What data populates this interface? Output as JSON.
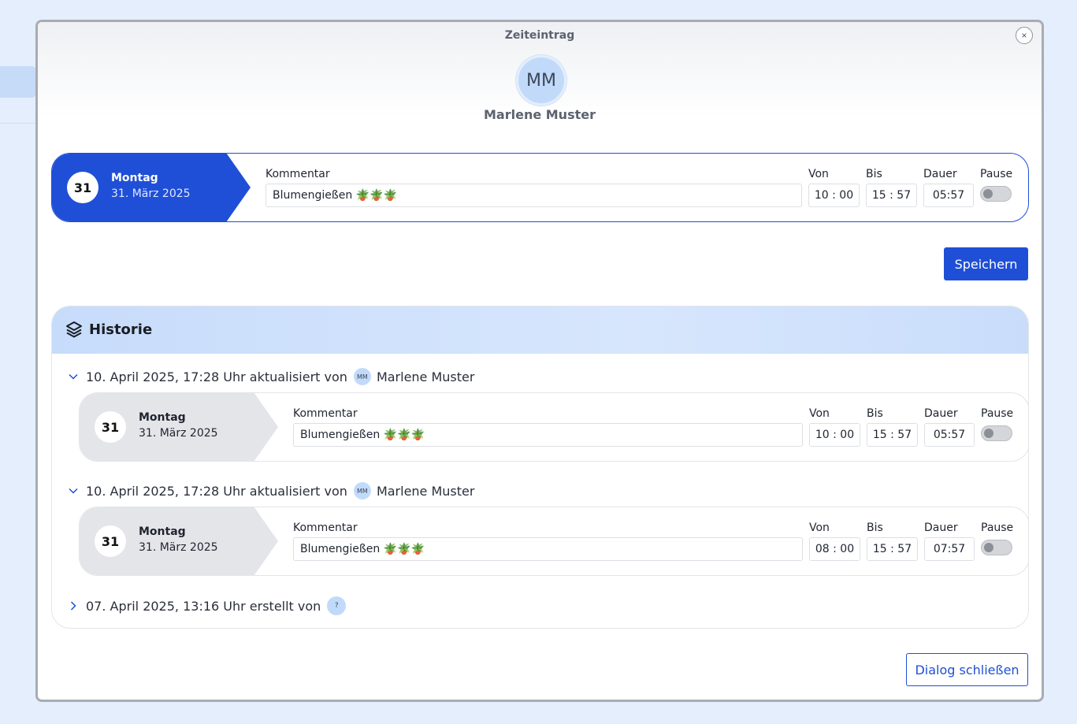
{
  "dialog": {
    "title": "Zeiteintrag",
    "close_label": "×",
    "user_initials": "MM",
    "user_name": "Marlene Muster"
  },
  "labels": {
    "comment": "Kommentar",
    "from": "Von",
    "to": "Bis",
    "duration": "Dauer",
    "pause": "Pause"
  },
  "entry": {
    "day": "31",
    "weekday": "Montag",
    "date": "31. März 2025",
    "comment": "Blumengießen 🪴🪴🪴",
    "from": "10 : 00",
    "to": "15 : 57",
    "duration": "05:57",
    "pause": false
  },
  "actions": {
    "save": "Speichern",
    "close_dialog": "Dialog schließen"
  },
  "history": {
    "title": "Historie",
    "items": [
      {
        "header": "10. April 2025, 17:28 Uhr aktualisiert von",
        "user_initials": "MM",
        "user_name": "Marlene Muster",
        "expanded": true,
        "entry": {
          "day": "31",
          "weekday": "Montag",
          "date": "31. März 2025",
          "comment": "Blumengießen 🪴🪴🪴",
          "from": "10 : 00",
          "to": "15 : 57",
          "duration": "05:57",
          "pause": false
        }
      },
      {
        "header": "10. April 2025, 17:28 Uhr aktualisiert von",
        "user_initials": "MM",
        "user_name": "Marlene Muster",
        "expanded": true,
        "entry": {
          "day": "31",
          "weekday": "Montag",
          "date": "31. März 2025",
          "comment": "Blumengießen 🪴🪴🪴",
          "from": "08 : 00",
          "to": "15 : 57",
          "duration": "07:57",
          "pause": false
        }
      },
      {
        "header": "07. April 2025, 13:16 Uhr erstellt von",
        "user_initials": "?",
        "expanded": false
      }
    ]
  },
  "colors": {
    "primary": "#1f4fd6",
    "avatar": "#c2dafa",
    "history_header": "#c7dcfb"
  }
}
